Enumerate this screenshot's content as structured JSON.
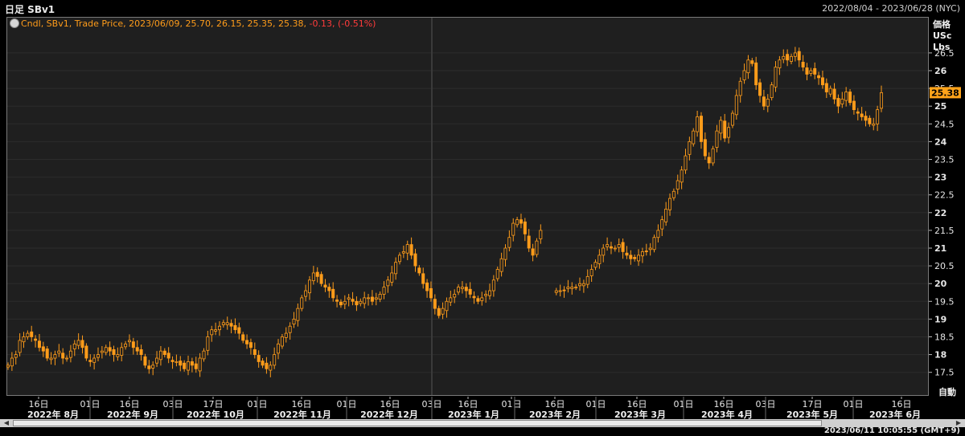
{
  "header": {
    "title": "日足 SBv1",
    "date_range": "2022/08/04 - 2023/06/28 (NYC)"
  },
  "legend": {
    "text": "Cndl, SBv1, Trade Price,  2023/06/09, 25.70, 26.15, 25.35, 25.38, ",
    "change": "-0.13, (-0.51%)"
  },
  "y_axis_units": [
    "価格",
    "USc",
    "Lbs"
  ],
  "auto_button": "自動",
  "timestamp": "2023/06/11 10:05:55  (GMT+9)",
  "colors": {
    "candle": "#ff9c1a",
    "background": "#1f1f1f",
    "last_price_box": "#ffa31a"
  },
  "chart_data": {
    "type": "candlestick",
    "last_price": "25.38",
    "ylim": [
      17.2,
      26.8
    ],
    "y_ticks": [
      "26.5",
      "26",
      "25.5",
      "25",
      "24.5",
      "24",
      "23.5",
      "23",
      "22.5",
      "22",
      "21.5",
      "21",
      "20.5",
      "20",
      "19.5",
      "19",
      "18.5",
      "18",
      "17.5"
    ],
    "x_day_labels": [
      "16日",
      "01日",
      "16日",
      "03日",
      "17日",
      "01日",
      "16日",
      "01日",
      "16日",
      "03日",
      "16日",
      "01日",
      "16日",
      "01日",
      "16日",
      "01日",
      "16日",
      "03日",
      "17日",
      "01日",
      "16日",
      "01日",
      "16日"
    ],
    "x_month_labels": [
      "2022年 8月",
      "2022年 9月",
      "2022年 10月",
      "2022年 11月",
      "2022年 12月",
      "2023年 1月",
      "2023年 2月",
      "2023年 3月",
      "2023年 4月",
      "2023年 5月",
      "2023年 6月"
    ],
    "closes": [
      17.7,
      17.9,
      18.0,
      18.4,
      18.5,
      18.6,
      18.5,
      18.4,
      18.2,
      18.1,
      17.9,
      17.9,
      18.0,
      18.1,
      17.9,
      17.9,
      18.1,
      18.3,
      18.4,
      18.2,
      17.9,
      17.8,
      17.9,
      18.0,
      18.1,
      18.2,
      18.1,
      18.0,
      18.0,
      18.2,
      18.3,
      18.4,
      18.2,
      18.1,
      18.0,
      17.7,
      17.6,
      17.7,
      17.9,
      18.1,
      18.0,
      17.9,
      17.8,
      17.8,
      17.7,
      17.6,
      17.8,
      17.7,
      17.6,
      17.9,
      18.1,
      18.5,
      18.7,
      18.7,
      18.8,
      18.9,
      18.9,
      18.8,
      18.7,
      18.6,
      18.4,
      18.3,
      18.2,
      18.0,
      17.8,
      17.7,
      17.6,
      17.7,
      18.0,
      18.3,
      18.5,
      18.6,
      18.8,
      19.0,
      19.3,
      19.6,
      19.8,
      20.1,
      20.3,
      20.2,
      20.0,
      19.9,
      19.8,
      19.6,
      19.5,
      19.4,
      19.5,
      19.6,
      19.5,
      19.4,
      19.5,
      19.6,
      19.6,
      19.5,
      19.6,
      19.7,
      19.9,
      20.1,
      20.3,
      20.6,
      20.8,
      20.9,
      21.1,
      20.8,
      20.5,
      20.3,
      20.0,
      19.8,
      19.6,
      19.3,
      19.1,
      19.3,
      19.5,
      19.6,
      19.7,
      19.9,
      19.9,
      19.8,
      19.7,
      19.6,
      19.5,
      19.6,
      19.7,
      19.8,
      20.1,
      20.4,
      20.7,
      21.0,
      21.3,
      21.7,
      21.8,
      21.7,
      21.4,
      21.0,
      20.8,
      21.2,
      21.5,
      null,
      null,
      null,
      19.8,
      19.8,
      19.8,
      19.9,
      19.9,
      19.9,
      20.0,
      20.0,
      20.2,
      20.4,
      20.6,
      20.8,
      21.0,
      21.1,
      21.0,
      21.0,
      21.1,
      20.9,
      20.8,
      20.7,
      20.7,
      20.8,
      20.9,
      20.9,
      21.0,
      21.3,
      21.5,
      21.8,
      22.1,
      22.4,
      22.6,
      22.9,
      23.2,
      23.6,
      24.0,
      24.3,
      24.7,
      24.0,
      23.6,
      23.4,
      23.8,
      24.3,
      24.6,
      24.1,
      24.4,
      24.8,
      25.3,
      25.7,
      26.0,
      26.3,
      26.2,
      25.6,
      25.3,
      25.0,
      25.2,
      25.6,
      26.1,
      26.3,
      26.4,
      26.3,
      26.4,
      26.5,
      26.3,
      26.1,
      25.9,
      26.0,
      25.9,
      25.8,
      25.6,
      25.4,
      25.5,
      25.2,
      25.0,
      25.2,
      25.4,
      25.1,
      24.9,
      24.8,
      24.7,
      24.6,
      24.5,
      24.5,
      24.9,
      25.38
    ]
  }
}
